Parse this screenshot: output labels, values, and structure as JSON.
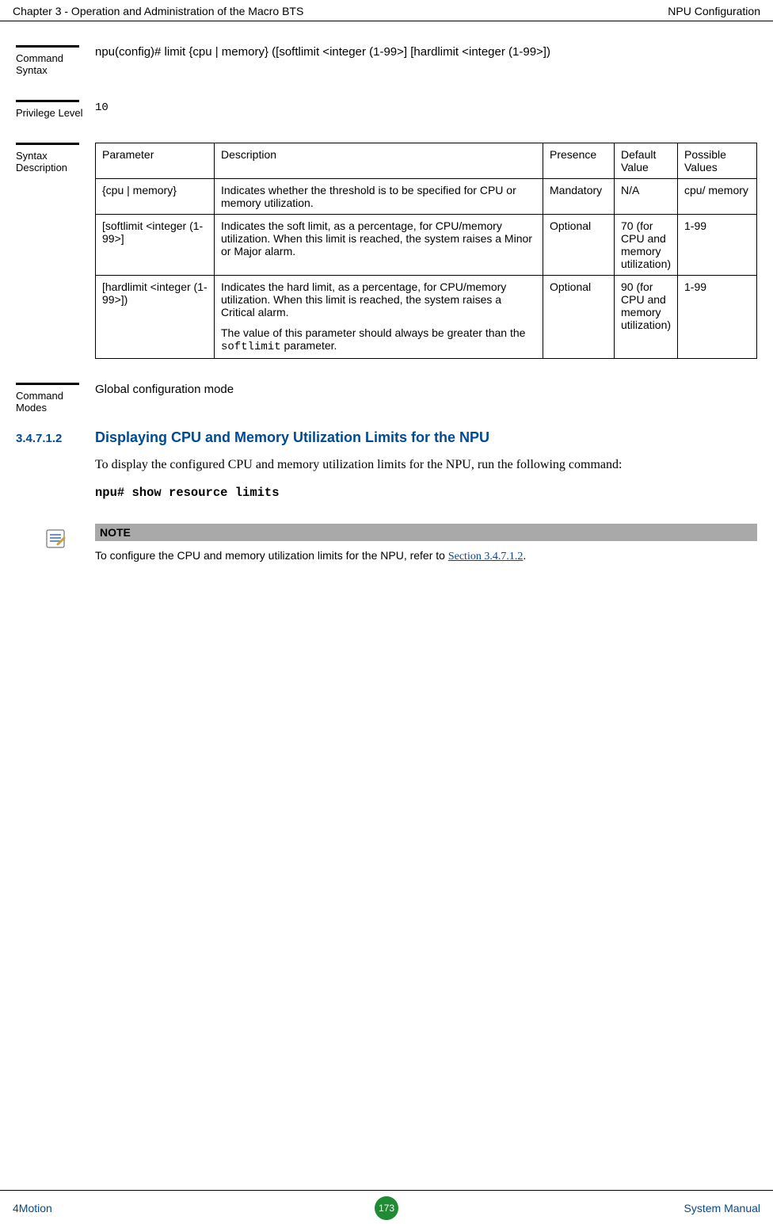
{
  "header": {
    "left": "Chapter 3 - Operation and Administration of the Macro BTS",
    "right": "NPU Configuration"
  },
  "sections": {
    "cmd_syntax": {
      "label": "Command Syntax",
      "value": "npu(config)# limit {cpu | memory} ([softlimit <integer (1-99>] [hardlimit <integer (1-99>])"
    },
    "priv": {
      "label": "Privilege Level",
      "value": "10"
    },
    "syntax_desc": {
      "label": "Syntax Description",
      "cols": {
        "parameter": "Parameter",
        "description": "Description",
        "presence": "Presence",
        "default_value": "Default Value",
        "possible_values": "Possible Values"
      },
      "rows": [
        {
          "parameter": "{cpu | memory}",
          "description": "Indicates whether the threshold is to be specified for CPU or memory utilization.",
          "presence": "Mandatory",
          "default_value": "N/A",
          "possible_values": "cpu/ memory"
        },
        {
          "parameter": "[softlimit <integer (1-99>]",
          "description": "Indicates the soft limit, as a percentage, for CPU/memory utilization. When this limit is reached, the system raises a Minor or Major alarm.",
          "presence": "Optional",
          "default_value": "70 (for CPU and memory utilization)",
          "possible_values": "1-99"
        },
        {
          "parameter": "[hardlimit <integer (1-99>])",
          "description_p1": "Indicates the hard limit, as a percentage, for CPU/memory utilization. When this limit is reached, the system raises a Critical alarm.",
          "description_p2_pre": "The value of this parameter should always be greater than the ",
          "description_p2_code": "softlimit",
          "description_p2_post": " parameter.",
          "presence": "Optional",
          "default_value": "90 (for CPU and memory utilization)",
          "possible_values": "1-99"
        }
      ]
    },
    "cmd_modes": {
      "label": "Command Modes",
      "value": "Global configuration mode"
    }
  },
  "subsection": {
    "number": "3.4.7.1.2",
    "title": "Displaying CPU and Memory Utilization Limits for the NPU",
    "body": "To display the configured CPU and memory utilization limits for the NPU, run the following command:",
    "command": "npu# show resource limits"
  },
  "note": {
    "label": "NOTE",
    "text_pre": "To configure the CPU and memory utilization limits for the NPU, refer to ",
    "link_text": "Section 3.4.7.1.2",
    "text_post": "."
  },
  "footer": {
    "left": "4Motion",
    "page": "173",
    "right": "System Manual"
  }
}
